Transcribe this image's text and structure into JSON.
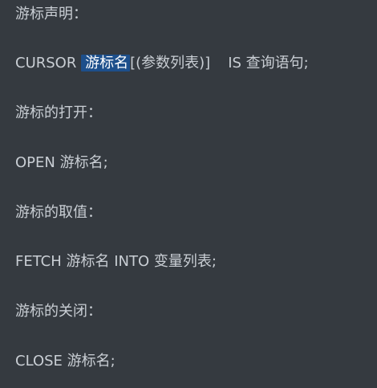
{
  "lines": {
    "declare_heading": "游标声明：",
    "declare_prefix": "CURSOR",
    "declare_highlight": "游标名",
    "declare_params": "[(参数列表)]",
    "declare_suffix": "IS 查询语句;",
    "open_heading": "游标的打开：",
    "open_statement": "OPEN 游标名;",
    "fetch_heading": "游标的取值：",
    "fetch_statement": "FETCH 游标名 INTO 变量列表;",
    "close_heading": "游标的关闭：",
    "close_statement": "CLOSE 游标名;"
  },
  "colors": {
    "background": "#353a40",
    "text": "#c9ced4",
    "highlight_bg": "#1d4f8b",
    "highlight_text": "#ffffff"
  }
}
